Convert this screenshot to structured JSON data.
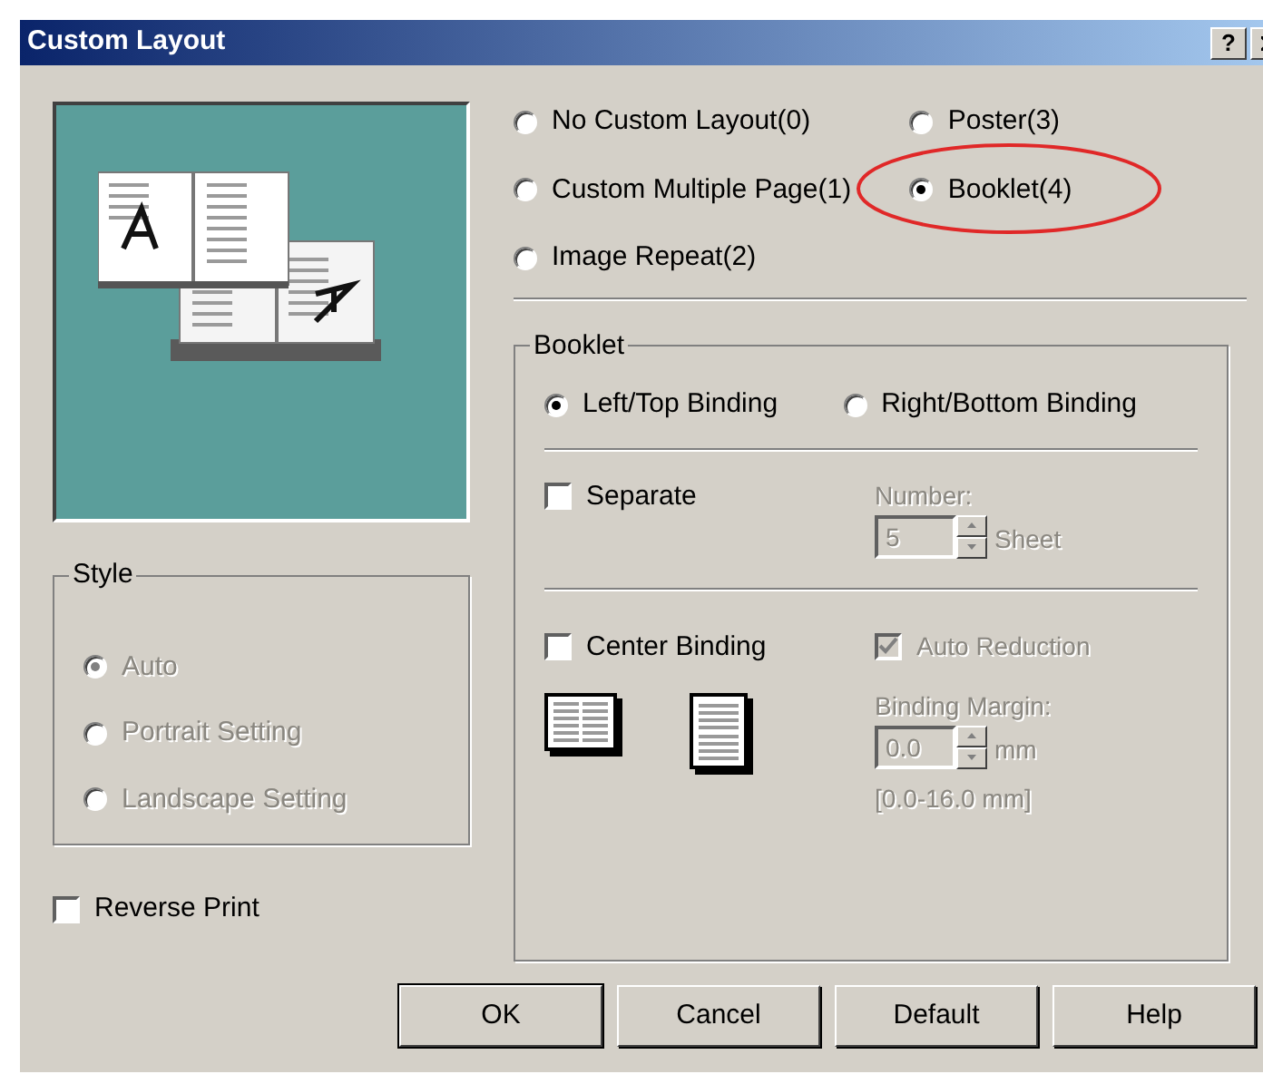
{
  "window": {
    "title": "Custom Layout",
    "help_button": "?"
  },
  "layout_options": [
    {
      "label": "No Custom Layout(0)",
      "selected": false,
      "highlighted": false
    },
    {
      "label": "Custom Multiple Page(1)",
      "selected": false,
      "highlighted": false
    },
    {
      "label": "Image Repeat(2)",
      "selected": false,
      "highlighted": false
    },
    {
      "label": "Poster(3)",
      "selected": false,
      "highlighted": false
    },
    {
      "label": "Booklet(4)",
      "selected": true,
      "highlighted": true
    }
  ],
  "style": {
    "title": "Style",
    "disabled": true,
    "options": [
      {
        "label": "Auto",
        "selected": true
      },
      {
        "label": "Portrait Setting",
        "selected": false
      },
      {
        "label": "Landscape Setting",
        "selected": false
      }
    ]
  },
  "reverse_print": {
    "label": "Reverse Print",
    "checked": false
  },
  "booklet": {
    "title": "Booklet",
    "binding": [
      {
        "label": "Left/Top Binding",
        "selected": true
      },
      {
        "label": "Right/Bottom Binding",
        "selected": false
      }
    ],
    "separate": {
      "label": "Separate",
      "checked": false
    },
    "number": {
      "label": "Number:",
      "value": "5",
      "unit": "Sheet",
      "disabled": true
    },
    "center_binding": {
      "label": "Center Binding",
      "checked": false
    },
    "auto_reduction": {
      "label": "Auto Reduction",
      "checked": true,
      "disabled": true
    },
    "binding_margin": {
      "label": "Binding Margin:",
      "value": "0.0",
      "unit": "mm",
      "range": "[0.0-16.0 mm]",
      "disabled": true
    }
  },
  "buttons": [
    "OK",
    "Cancel",
    "Default",
    "Help"
  ]
}
